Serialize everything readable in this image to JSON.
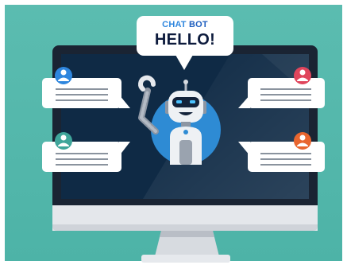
{
  "header_bubble": {
    "word_chat": "CHAT",
    "word_bot": "BOT",
    "greeting": "HELLO!"
  },
  "colors": {
    "background": "#55b8ab",
    "screen": "#0f2a45",
    "monitor_frame": "#1a2433",
    "robot_circle": "#2e8bd4",
    "avatar_blue": "#2e86de",
    "avatar_red": "#e0455c",
    "avatar_teal": "#3fa59a",
    "avatar_orange": "#e8662f"
  },
  "icons": {
    "avatar_top_left": "user-icon",
    "avatar_top_right": "user-icon",
    "avatar_bottom_left": "user-icon",
    "avatar_bottom_right": "user-icon"
  }
}
